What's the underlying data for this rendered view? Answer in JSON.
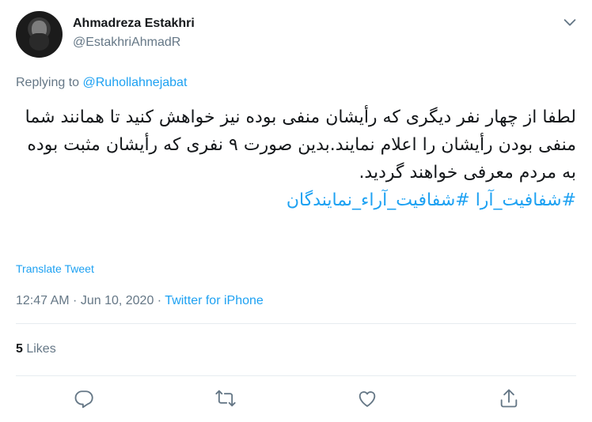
{
  "author": {
    "name": "Ahmadreza Estakhri",
    "handle": "@EstakhriAhmadR"
  },
  "reply": {
    "prefix": "Replying to ",
    "to": "@Ruhollahnejabat"
  },
  "tweet": {
    "text": "لطفا از چهار نفر دیگری که رأیشان منفی بوده نیز خواهش کنید تا همانند شما منفی بودن رأیشان را اعلام نمایند.بدین صورت ۹ نفری که رأیشان مثبت بوده به مردم معرفی خواهند گردید.",
    "hashtags": "#شفافیت_آرا #شفافیت_آراء_نمایندگان"
  },
  "translate_label": "Translate Tweet",
  "meta": {
    "time": "12:47 AM",
    "sep1": " · ",
    "date": "Jun 10, 2020",
    "sep2": " · ",
    "source": "Twitter for iPhone"
  },
  "likes": {
    "count": "5",
    "label": " Likes"
  },
  "icons": {
    "caret": "chevron-down-icon",
    "reply": "reply-icon",
    "retweet": "retweet-icon",
    "like": "heart-icon",
    "share": "share-icon"
  },
  "colors": {
    "accent": "#1da1f2",
    "secondary_text": "#657786",
    "primary_text": "#14171a"
  }
}
